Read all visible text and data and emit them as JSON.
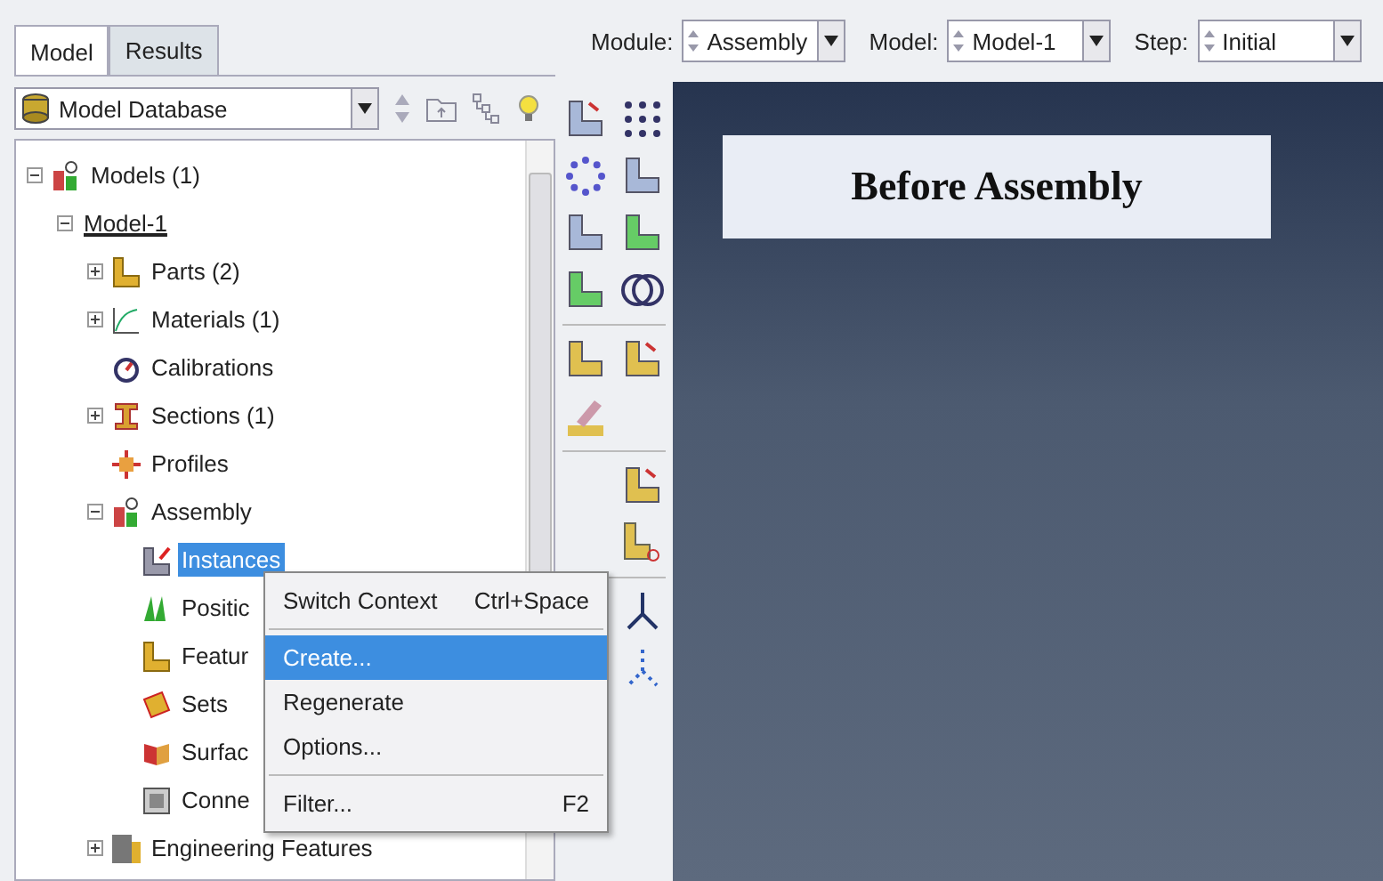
{
  "tabs": [
    {
      "label": "Model",
      "selected": true
    },
    {
      "label": "Results",
      "selected": false
    }
  ],
  "database_selector": {
    "value": "Model Database"
  },
  "toolbar": {
    "combos": [
      {
        "label": "Module:",
        "value": "Assembly"
      },
      {
        "label": "Model:",
        "value": "Model-1"
      },
      {
        "label": "Step:",
        "value": "Initial"
      }
    ]
  },
  "tree": [
    {
      "label": "Models (1)",
      "kind": "models",
      "expanded": true,
      "selected": false,
      "children": [
        {
          "label": "Model-1",
          "kind": "model",
          "expanded": true,
          "selected": false,
          "current": true,
          "children": [
            {
              "label": "Parts (2)",
              "kind": "parts",
              "expanded": false,
              "selected": false
            },
            {
              "label": "Materials (1)",
              "kind": "materials",
              "expanded": false,
              "selected": false
            },
            {
              "label": "Calibrations",
              "kind": "calibrations",
              "selected": false
            },
            {
              "label": "Sections (1)",
              "kind": "sections",
              "expanded": false,
              "selected": false
            },
            {
              "label": "Profiles",
              "kind": "profiles",
              "selected": false
            },
            {
              "label": "Assembly",
              "kind": "assembly",
              "expanded": true,
              "selected": false,
              "children": [
                {
                  "label": "Instances",
                  "kind": "instances",
                  "selected": true
                },
                {
                  "label": "Positic",
                  "kind": "positions",
                  "selected": false
                },
                {
                  "label": "Featur",
                  "kind": "features",
                  "selected": false
                },
                {
                  "label": "Sets",
                  "kind": "sets",
                  "selected": false
                },
                {
                  "label": "Surfac",
                  "kind": "surfaces",
                  "selected": false
                },
                {
                  "label": "Conne",
                  "kind": "connectors",
                  "selected": false
                }
              ]
            },
            {
              "label": "Engineering Features",
              "kind": "engineering",
              "expanded": false,
              "selected": false
            }
          ]
        }
      ]
    }
  ],
  "context_menu": [
    {
      "kind": "item",
      "label": "Switch Context",
      "shortcut": "Ctrl+Space",
      "selected": false
    },
    {
      "kind": "separator"
    },
    {
      "kind": "item",
      "label": "Create...",
      "selected": true
    },
    {
      "kind": "item",
      "label": "Regenerate",
      "selected": false
    },
    {
      "kind": "item",
      "label": "Options...",
      "selected": false
    },
    {
      "kind": "separator"
    },
    {
      "kind": "item",
      "label": "Filter...",
      "shortcut": "F2",
      "selected": false
    }
  ],
  "viewport": {
    "title": "Before Assembly"
  }
}
